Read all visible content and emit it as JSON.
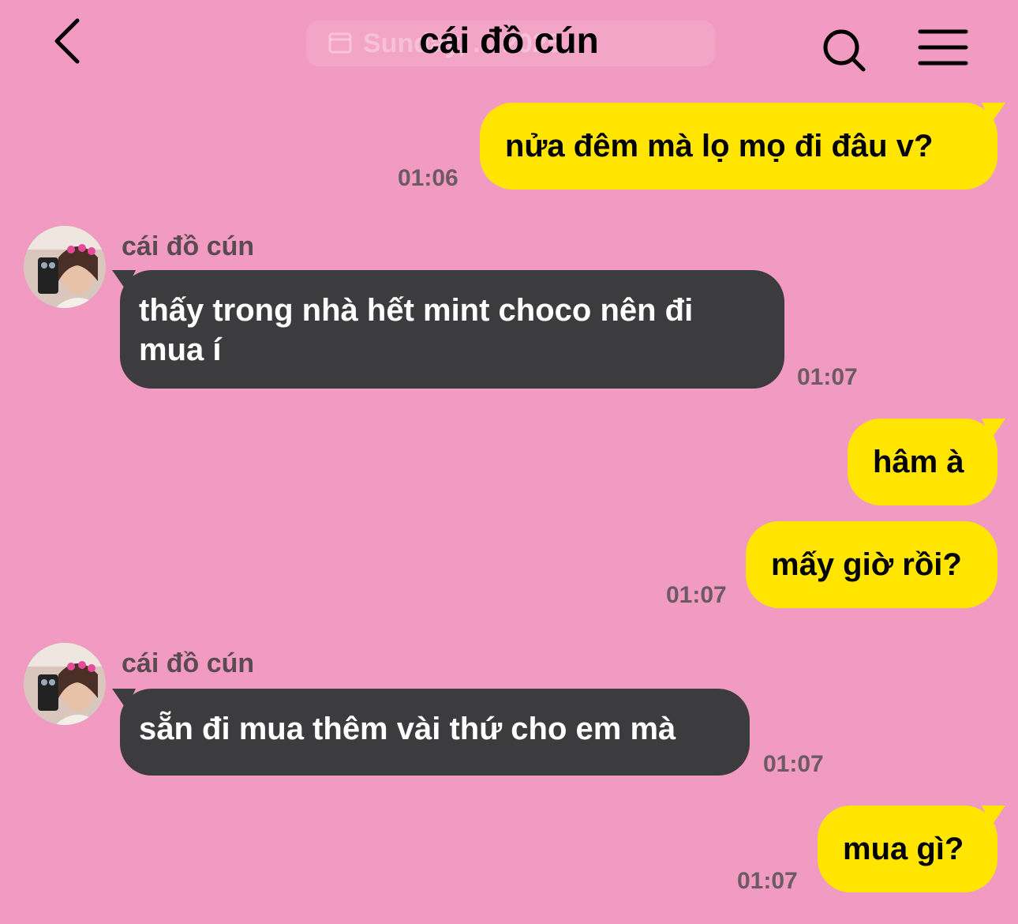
{
  "header": {
    "title": "cái đồ cún",
    "date_label": "Sunday, ... 2025",
    "icons": {
      "back": "chevron-left-icon",
      "search": "search-icon",
      "menu": "hamburger-menu-icon",
      "date": "calendar-icon"
    }
  },
  "colors": {
    "background": "#f29bc2",
    "outgoing_bubble": "#ffe500",
    "incoming_bubble": "#3c3c3e",
    "timestamp": "#6d5a63"
  },
  "messages": [
    {
      "direction": "out",
      "text": "nửa đêm mà lọ mọ đi đâu v?",
      "time": "01:06"
    },
    {
      "direction": "in",
      "sender": "cái đồ cún",
      "text": "thấy trong nhà hết mint choco nên đi mua í",
      "time": "01:07"
    },
    {
      "direction": "out",
      "text": "hâm à",
      "time": ""
    },
    {
      "direction": "out",
      "text": "mấy giờ rồi?",
      "time": "01:07"
    },
    {
      "direction": "in",
      "sender": "cái đồ cún",
      "text": "sẵn đi mua thêm vài thứ cho em mà",
      "time": "01:07"
    },
    {
      "direction": "out",
      "text": "mua gì?",
      "time": "01:07"
    }
  ]
}
